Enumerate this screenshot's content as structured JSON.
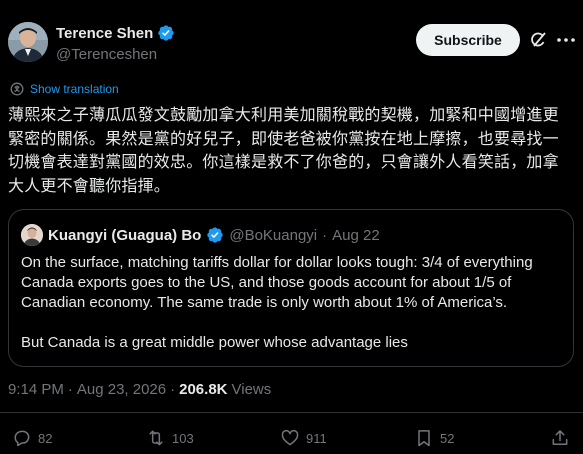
{
  "author": {
    "name": "Terence Shen",
    "handle": "@Terenceshen"
  },
  "header": {
    "subscribe_label": "Subscribe"
  },
  "translation": {
    "label": "Show translation"
  },
  "tweet": {
    "text": "薄熙來之子薄瓜瓜發文鼓勵加拿大利用美加關稅戰的契機，加緊和中國增進更緊密的關係。果然是黨的好兒子，即使老爸被你黨按在地上摩擦，也要尋找一切機會表達對黨國的效忠。你這樣是救不了你爸的，只會讓外人看笑話，加拿大人更不會聽你指揮。"
  },
  "quote": {
    "name": "Kuangyi (Guagua) Bo",
    "handle": "@BoKuangyi",
    "dot": "·",
    "date": "Aug 22",
    "paragraph1": "On the surface, matching tariffs dollar for dollar looks tough: 3/4 of everything Canada exports goes to the US, and those goods account for about 1/5 of Canadian economy. The same trade is only worth about 1% of America’s.",
    "paragraph2": "But Canada is a great middle power whose advantage lies"
  },
  "meta": {
    "time": "9:14 PM",
    "dot": "·",
    "date": "Aug 23, 2026",
    "dot2": "·",
    "views_count": "206.8K",
    "views_label": "Views"
  },
  "actions": {
    "replies": "82",
    "reposts": "103",
    "likes": "911",
    "bookmarks": "52"
  },
  "colors": {
    "background": "#000000",
    "text": "#e7e9ea",
    "secondary": "#71767b",
    "accent": "#1d9bf0",
    "border": "#333639"
  },
  "icons": [
    "verified-badge-icon",
    "grok-icon",
    "more-icon",
    "translate-icon",
    "reply-icon",
    "repost-icon",
    "like-icon",
    "bookmark-icon",
    "share-icon"
  ]
}
